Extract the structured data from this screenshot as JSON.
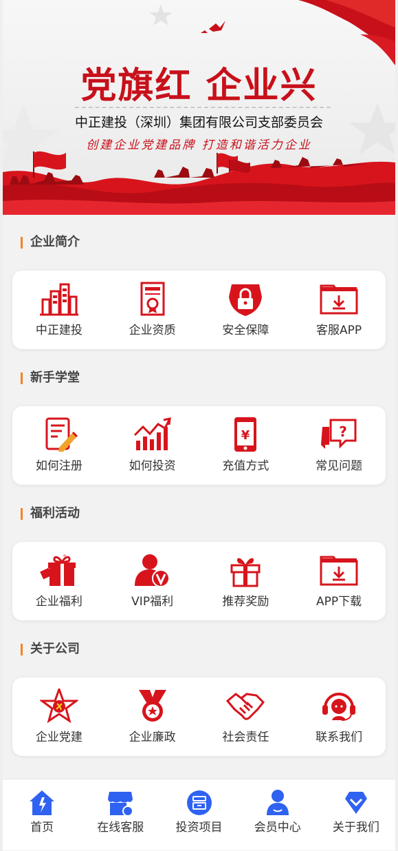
{
  "banner": {
    "title": "党旗红  企业兴",
    "subtitle": "中正建投（深圳）集团有限公司支部委员会",
    "slogan": "创建企业党建品牌  打造和谐活力企业"
  },
  "sections": [
    {
      "title": "企业简介",
      "items": [
        {
          "label": "中正建投",
          "icon": "buildings-icon"
        },
        {
          "label": "企业资质",
          "icon": "certificate-icon"
        },
        {
          "label": "安全保障",
          "icon": "lock-shield-icon"
        },
        {
          "label": "客服APP",
          "icon": "download-folder-icon"
        }
      ]
    },
    {
      "title": "新手学堂",
      "items": [
        {
          "label": "如何注册",
          "icon": "form-pencil-icon"
        },
        {
          "label": "如何投资",
          "icon": "trend-chart-icon"
        },
        {
          "label": "充值方式",
          "icon": "phone-yuan-icon"
        },
        {
          "label": "常见问题",
          "icon": "question-bubble-icon"
        }
      ]
    },
    {
      "title": "福利活动",
      "items": [
        {
          "label": "企业福利",
          "icon": "gift-icon"
        },
        {
          "label": "VIP福利",
          "icon": "vip-user-icon"
        },
        {
          "label": "推荐奖励",
          "icon": "gift-box-icon"
        },
        {
          "label": "APP下载",
          "icon": "download-folder-icon"
        }
      ]
    },
    {
      "title": "关于公司",
      "items": [
        {
          "label": "企业党建",
          "icon": "party-star-icon"
        },
        {
          "label": "企业廉政",
          "icon": "medal-icon"
        },
        {
          "label": "社会责任",
          "icon": "handshake-icon"
        },
        {
          "label": "联系我们",
          "icon": "headset-icon"
        }
      ]
    }
  ],
  "tabbar": [
    {
      "label": "首页",
      "icon": "home-icon"
    },
    {
      "label": "在线客服",
      "icon": "store-icon"
    },
    {
      "label": "投资项目",
      "icon": "project-icon"
    },
    {
      "label": "会员中心",
      "icon": "user-icon"
    },
    {
      "label": "关于我们",
      "icon": "about-icon"
    }
  ],
  "colors": {
    "brand_red": "#d7141c",
    "accent_orange": "#f5821f",
    "tab_blue": "#2f62f0"
  }
}
